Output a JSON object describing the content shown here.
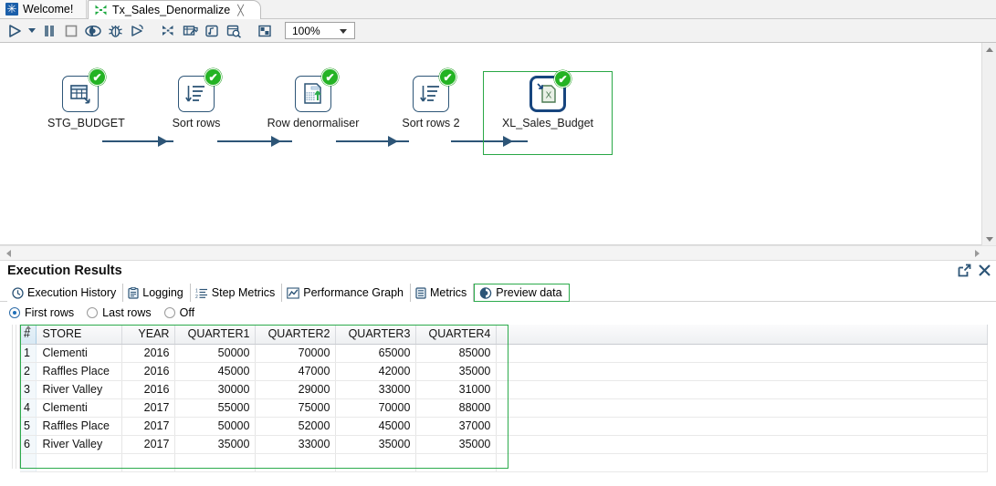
{
  "window": {
    "editor_tabs": [
      {
        "label": "Welcome!",
        "icon": "welcome-icon",
        "active": false,
        "closeable": false
      },
      {
        "label": "Tx_Sales_Denormalize",
        "icon": "transformation-icon",
        "active": true,
        "closeable": true,
        "close_glyph": "╳"
      }
    ]
  },
  "toolbar": {
    "buttons": [
      {
        "name": "run-button",
        "icon": "play-icon"
      },
      {
        "name": "run-options-dropdown",
        "icon": "chevron-down-icon"
      },
      {
        "name": "pause-button",
        "icon": "pause-icon"
      },
      {
        "name": "stop-button",
        "icon": "stop-icon"
      },
      {
        "name": "preview-button",
        "icon": "eye-icon"
      },
      {
        "name": "debug-button",
        "icon": "bug-icon"
      },
      {
        "name": "replay-button",
        "icon": "play-outline-icon"
      },
      {
        "name": "verify-button",
        "icon": "transformation-check-icon"
      },
      {
        "name": "impact-analysis-button",
        "icon": "grid-arrow-icon"
      },
      {
        "name": "show-sql-button",
        "icon": "database-note-icon"
      },
      {
        "name": "search-metadata-button",
        "icon": "database-search-icon"
      },
      {
        "name": "arrange-button",
        "icon": "layout-icon"
      }
    ],
    "zoom": {
      "value": "100%",
      "caret": "chevron-down-icon"
    }
  },
  "canvas": {
    "steps": [
      {
        "id": "stg-budget",
        "label": "STG_BUDGET",
        "icon": "table-input-icon",
        "status": "success",
        "selected": false
      },
      {
        "id": "sort-rows",
        "label": "Sort rows",
        "icon": "sort-icon",
        "status": "success",
        "selected": false
      },
      {
        "id": "row-denormaliser",
        "label": "Row denormaliser",
        "icon": "row-denormaliser-icon",
        "status": "success",
        "selected": false
      },
      {
        "id": "sort-rows-2",
        "label": "Sort rows 2",
        "icon": "sort-icon",
        "status": "success",
        "selected": false
      },
      {
        "id": "xl-sales-budget",
        "label": "XL_Sales_Budget",
        "icon": "excel-output-icon",
        "status": "success",
        "selected": true
      }
    ]
  },
  "execution_results": {
    "title": "Execution Results",
    "actions": [
      {
        "name": "detach-view-button",
        "icon": "external-link-icon"
      },
      {
        "name": "close-view-button",
        "icon": "close-icon"
      }
    ],
    "tabs": [
      {
        "label": "Execution History",
        "icon": "history-clock-icon",
        "active": false
      },
      {
        "label": "Logging",
        "icon": "log-document-icon",
        "active": false
      },
      {
        "label": "Step Metrics",
        "icon": "step-metrics-icon",
        "active": false
      },
      {
        "label": "Performance Graph",
        "icon": "line-chart-icon",
        "active": false
      },
      {
        "label": "Metrics",
        "icon": "metrics-icon",
        "active": false
      },
      {
        "label": "Preview data",
        "icon": "preview-data-icon",
        "active": true
      }
    ],
    "row_mode": {
      "options": [
        {
          "label": "First rows",
          "selected": true
        },
        {
          "label": "Last rows",
          "selected": false
        },
        {
          "label": "Off",
          "selected": false
        }
      ]
    },
    "preview_table": {
      "index_header": "#",
      "columns": [
        {
          "label": "STORE",
          "align": "left"
        },
        {
          "label": "YEAR",
          "align": "right"
        },
        {
          "label": "QUARTER1",
          "align": "right"
        },
        {
          "label": "QUARTER2",
          "align": "right"
        },
        {
          "label": "QUARTER3",
          "align": "right"
        },
        {
          "label": "QUARTER4",
          "align": "right"
        }
      ],
      "rows": [
        {
          "idx": "1",
          "cells": [
            "Clementi",
            "2016",
            "50000",
            "70000",
            "65000",
            "85000"
          ]
        },
        {
          "idx": "2",
          "cells": [
            "Raffles Place",
            "2016",
            "45000",
            "47000",
            "42000",
            "35000"
          ]
        },
        {
          "idx": "3",
          "cells": [
            "River Valley",
            "2016",
            "30000",
            "29000",
            "33000",
            "31000"
          ]
        },
        {
          "idx": "4",
          "cells": [
            "Clementi",
            "2017",
            "55000",
            "75000",
            "70000",
            "88000"
          ]
        },
        {
          "idx": "5",
          "cells": [
            "Raffles Place",
            "2017",
            "50000",
            "52000",
            "45000",
            "37000"
          ]
        },
        {
          "idx": "6",
          "cells": [
            "River Valley",
            "2017",
            "35000",
            "33000",
            "35000",
            "35000"
          ]
        }
      ]
    }
  },
  "colors": {
    "accent_blue": "#2d5577",
    "success_green": "#24b324",
    "selection_green": "#2cab4c",
    "selected_step_blue": "#17457e",
    "tab_bg": "#f2f2f2"
  }
}
